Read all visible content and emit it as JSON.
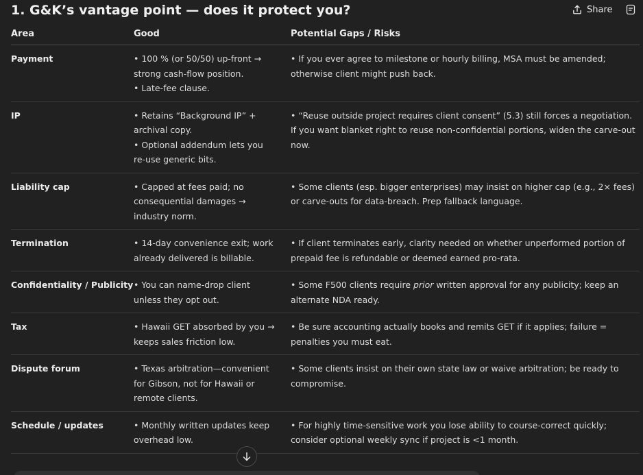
{
  "header": {
    "title": "1. G&K’s vantage point — does it protect you?",
    "share_label": "Share"
  },
  "icons": {
    "share": "share-icon",
    "notes": "notes-icon",
    "scroll": "arrow-down-icon"
  },
  "table": {
    "headers": [
      "Area",
      "Good",
      "Potential Gaps / Risks"
    ],
    "rows": [
      {
        "area": "Payment",
        "good": [
          "• 100 % (or 50/50) up-front → strong cash-flow position.",
          "• Late-fee clause."
        ],
        "gaps": [
          "• If you ever agree to milestone or hourly billing, MSA must be amended; otherwise client might push back."
        ]
      },
      {
        "area": "IP",
        "good": [
          "• Retains “Background IP” + archival copy.",
          "• Optional addendum lets you re-use generic bits."
        ],
        "gaps": [
          "• “Reuse outside project requires client consent” (5.3) still forces a negotiation. If you want blanket right to reuse non-confidential portions, widen the carve-out now."
        ]
      },
      {
        "area": "Liability cap",
        "good": [
          "• Capped at fees paid; no consequential damages → industry norm."
        ],
        "gaps": [
          "• Some clients (esp. bigger enterprises) may insist on higher cap (e.g., 2× fees) or carve-outs for data-breach. Prep fallback language."
        ]
      },
      {
        "area": "Termination",
        "good": [
          "• 14-day convenience exit; work already delivered is billable."
        ],
        "gaps": [
          "• If client terminates early, clarity needed on whether unperformed portion of prepaid fee is refundable or deemed earned pro-rata."
        ]
      },
      {
        "area": "Confidentiality / Publicity",
        "good": [
          "• You can name-drop client unless they opt out."
        ],
        "gaps_pre": "• Some F500 clients require ",
        "gaps_em": "prior",
        "gaps_post": " written approval for any publicity; keep an alternate NDA ready."
      },
      {
        "area": "Tax",
        "good": [
          "• Hawaii GET absorbed by you → keeps sales friction low."
        ],
        "gaps": [
          "• Be sure accounting actually books and remits GET if it applies; failure = penalties you must eat."
        ]
      },
      {
        "area": "Dispute forum",
        "good": [
          "• Texas arbitration—convenient for Gibson, not for Hawaii or remote clients."
        ],
        "gaps": [
          "• Some clients insist on their own state law or waive arbitration; be ready to compromise."
        ]
      },
      {
        "area": "Schedule / updates",
        "good": [
          "• Monthly written updates keep overhead low."
        ],
        "gaps": [
          "• For highly time-sensitive work you lose ability to course-correct quickly; consider optional weekly sync if project is <1 month."
        ]
      }
    ]
  }
}
